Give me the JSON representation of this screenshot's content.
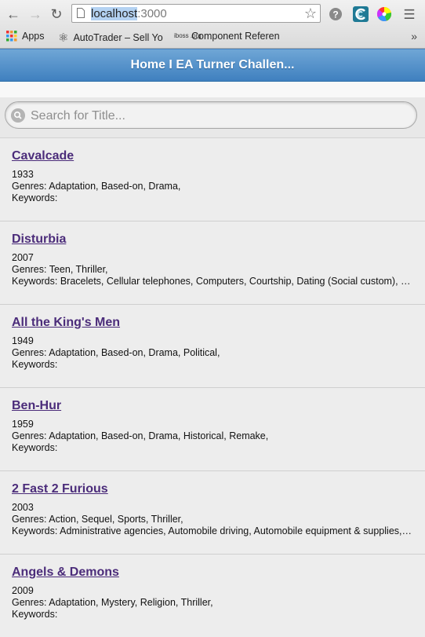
{
  "browser": {
    "url_host": "localhost",
    "url_port": ":3000",
    "bookmarks": [
      {
        "label": "Apps"
      },
      {
        "label": "AutoTrader – Sell Yo"
      },
      {
        "label": "Component Referen",
        "favicon_text": "iboss .org"
      }
    ],
    "overflow_label": "»"
  },
  "header": {
    "title": "Home I EA Turner Challen..."
  },
  "search": {
    "placeholder": "Search for Title..."
  },
  "movies": [
    {
      "title": "Cavalcade",
      "year": "1933",
      "genres": "Genres: Adaptation, Based-on, Drama,",
      "keywords": "Keywords:"
    },
    {
      "title": "Disturbia",
      "year": "2007",
      "genres": "Genres: Teen, Thriller,",
      "keywords": "Keywords: Bracelets, Cellular telephones, Computers, Courtship, Dating (Social custom), El..."
    },
    {
      "title": "All the King's Men",
      "year": "1949",
      "genres": "Genres: Adaptation, Based-on, Drama, Political,",
      "keywords": "Keywords:"
    },
    {
      "title": "Ben-Hur",
      "year": "1959",
      "genres": "Genres: Adaptation, Based-on, Drama, Historical, Remake,",
      "keywords": "Keywords:"
    },
    {
      "title": "2 Fast 2 Furious",
      "year": "2003",
      "genres": "Genres: Action, Sequel, Sports, Thriller,",
      "keywords": "Keywords: Administrative agencies, Automobile driving, Automobile equipment & supplies, ..."
    },
    {
      "title": "Angels & Demons",
      "year": "2009",
      "genres": "Genres: Adaptation, Mystery, Religion, Thriller,",
      "keywords": "Keywords:"
    }
  ]
}
